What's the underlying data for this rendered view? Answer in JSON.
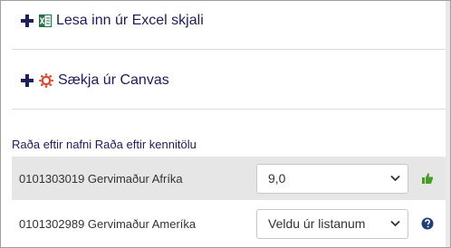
{
  "panels": [
    {
      "label": "Lesa inn úr Excel skjali",
      "icon": "excel-icon"
    },
    {
      "label": "Sækja úr Canvas",
      "icon": "canvas-icon"
    }
  ],
  "sort": {
    "by_name": "Raða eftir nafni",
    "by_id": "Raða eftir kennitölu"
  },
  "students": [
    {
      "id_name": "0101303019 Gervimaður Afríka",
      "grade": "9,0",
      "status_icon": "thumbs-up-icon"
    },
    {
      "id_name": "0101302989 Gervimaður Ameríka",
      "grade": "Veldu úr listanum",
      "status_icon": "question-icon"
    }
  ],
  "colors": {
    "accent": "#1c1c5e",
    "row_highlight": "#e6e6e6",
    "ok": "#4a9a2e",
    "help": "#1f3f7a",
    "excel": "#217346",
    "canvas": "#e1462f"
  }
}
